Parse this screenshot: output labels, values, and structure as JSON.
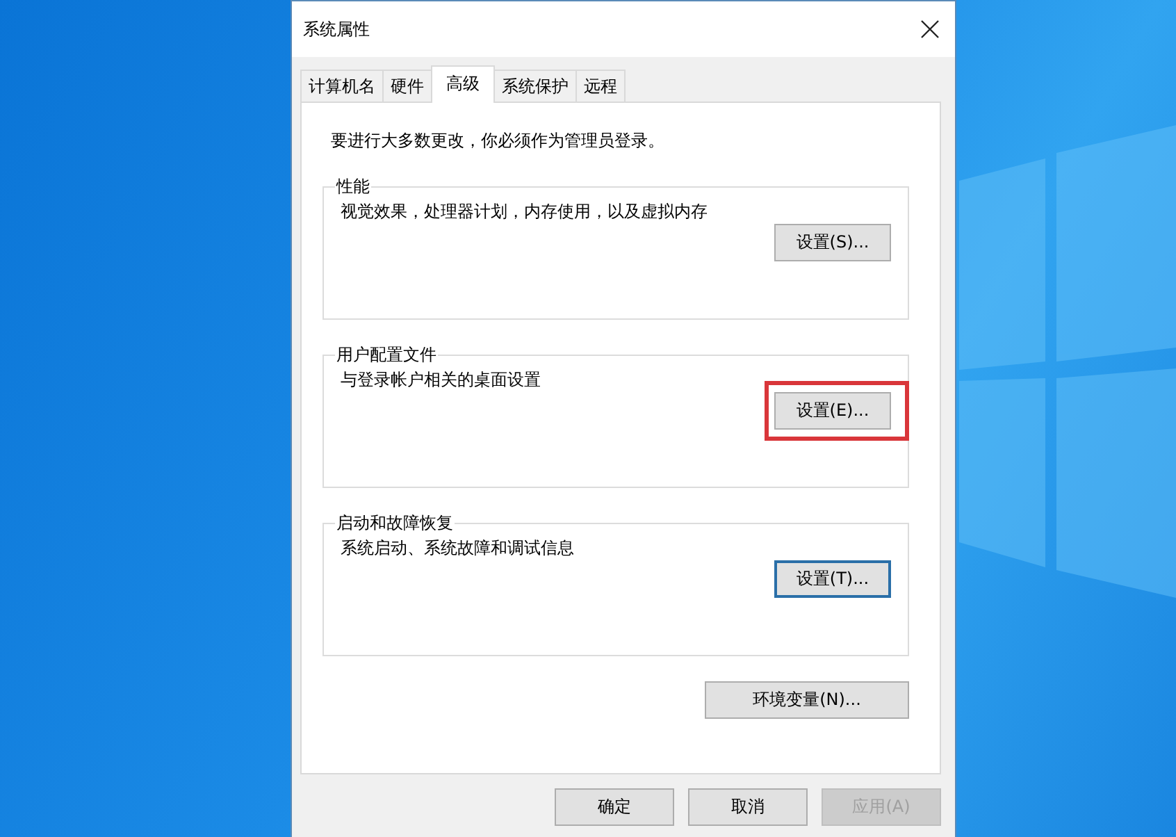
{
  "window": {
    "title": "系统属性"
  },
  "tabs": [
    {
      "label": "计算机名",
      "selected": false
    },
    {
      "label": "硬件",
      "selected": false
    },
    {
      "label": "高级",
      "selected": true
    },
    {
      "label": "系统保护",
      "selected": false
    },
    {
      "label": "远程",
      "selected": false
    }
  ],
  "notice": "要进行大多数更改，你必须作为管理员登录。",
  "groups": [
    {
      "title": "性能",
      "description": "视觉效果，处理器计划，内存使用，以及虚拟内存",
      "button": {
        "label": "设置(S)...",
        "focused": false,
        "highlighted": false
      }
    },
    {
      "title": "用户配置文件",
      "description": "与登录帐户相关的桌面设置",
      "button": {
        "label": "设置(E)...",
        "focused": false,
        "highlighted": true
      }
    },
    {
      "title": "启动和故障恢复",
      "description": "系统启动、系统故障和调试信息",
      "button": {
        "label": "设置(T)...",
        "focused": true,
        "highlighted": false
      }
    }
  ],
  "env_button": "环境变量(N)...",
  "buttons": [
    {
      "label": "确定",
      "disabled": false
    },
    {
      "label": "取消",
      "disabled": false
    },
    {
      "label": "应用(A)",
      "disabled": true
    }
  ]
}
